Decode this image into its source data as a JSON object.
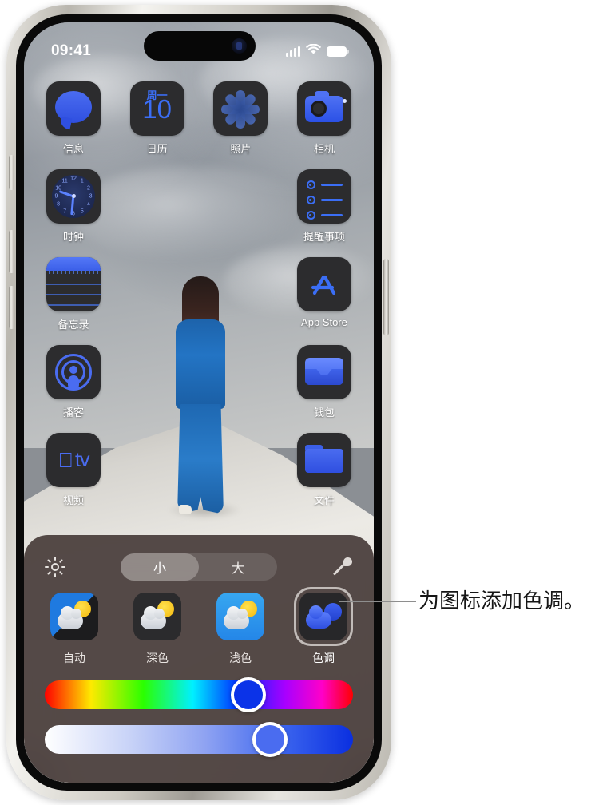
{
  "status_bar": {
    "time": "09:41",
    "icons": [
      "cellular-signal-icon",
      "wifi-icon",
      "battery-icon"
    ]
  },
  "home_screen": {
    "rows": [
      [
        {
          "label": "信息",
          "icon": "messages-icon"
        },
        {
          "label": "日历",
          "icon": "calendar-icon",
          "weekday": "周一",
          "day": "10"
        },
        {
          "label": "照片",
          "icon": "photos-icon"
        },
        {
          "label": "相机",
          "icon": "camera-icon"
        }
      ],
      [
        {
          "label": "时钟",
          "icon": "clock-icon"
        },
        {
          "label": "",
          "icon": "empty-slot"
        },
        {
          "label": "",
          "icon": "empty-slot"
        },
        {
          "label": "提醒事项",
          "icon": "reminders-icon"
        }
      ],
      [
        {
          "label": "备忘录",
          "icon": "notes-icon"
        },
        {
          "label": "",
          "icon": "empty-slot"
        },
        {
          "label": "",
          "icon": "empty-slot"
        },
        {
          "label": "App Store",
          "icon": "app-store-icon"
        }
      ],
      [
        {
          "label": "播客",
          "icon": "podcasts-icon"
        },
        {
          "label": "",
          "icon": "empty-slot"
        },
        {
          "label": "",
          "icon": "empty-slot"
        },
        {
          "label": "钱包",
          "icon": "wallet-icon"
        }
      ],
      [
        {
          "label": "视频",
          "icon": "apple-tv-icon"
        },
        {
          "label": "",
          "icon": "empty-slot"
        },
        {
          "label": "",
          "icon": "empty-slot"
        },
        {
          "label": "文件",
          "icon": "files-icon"
        }
      ]
    ],
    "clock_ticks": [
      "12",
      "1",
      "2",
      "3",
      "4",
      "5",
      "6",
      "7",
      "8",
      "9",
      "10",
      "11"
    ]
  },
  "customize_panel": {
    "brightness_icon": "sun-brightness-icon",
    "eyedropper_icon": "eyedropper-icon",
    "size_segmented": {
      "options": [
        {
          "label": "小",
          "selected": true
        },
        {
          "label": "大",
          "selected": false
        }
      ]
    },
    "appearance_options": [
      {
        "label": "自动",
        "mode": "auto",
        "selected": false
      },
      {
        "label": "深色",
        "mode": "dark",
        "selected": false
      },
      {
        "label": "浅色",
        "mode": "light",
        "selected": false
      },
      {
        "label": "色调",
        "mode": "tinted",
        "selected": true
      }
    ],
    "sliders": [
      {
        "name": "hue-slider",
        "percent": 66,
        "thumb_color": "#0b33e8"
      },
      {
        "name": "tint-amount-slider",
        "percent": 73,
        "thumb_color": "#4a6cf0"
      }
    ]
  },
  "callout": {
    "text": "为图标添加色调。"
  },
  "colors": {
    "panel_background": "#4a3f3d",
    "icon_tint_blue": "#3b5fe8",
    "accent_white": "#ffffff"
  }
}
